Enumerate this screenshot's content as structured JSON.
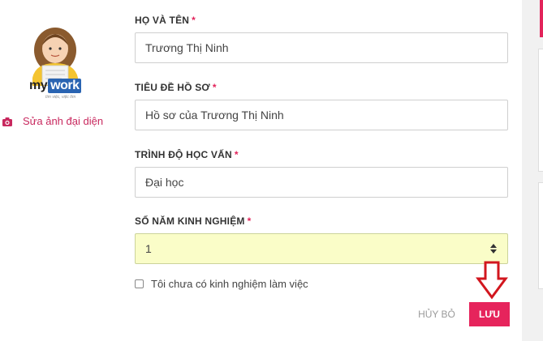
{
  "logo": {
    "brand_my": "my",
    "brand_work": "work",
    "tagline": "tìm việc, việc tìm"
  },
  "avatar": {
    "edit_label": "Sửa ảnh đại diện"
  },
  "form": {
    "full_name": {
      "label": "HỌ VÀ TÊN",
      "required_mark": "*",
      "value": "Trương Thị Ninh"
    },
    "profile_title": {
      "label": "TIÊU ĐỀ HỒ SƠ",
      "required_mark": "*",
      "value": "Hồ sơ của Trương Thị Ninh"
    },
    "education": {
      "label": "TRÌNH ĐỘ HỌC VẤN",
      "required_mark": "*",
      "value": "Đại học"
    },
    "experience_years": {
      "label": "SỐ NĂM KINH NGHIỆM",
      "required_mark": "*",
      "value": "1"
    },
    "no_experience": {
      "label": "Tôi chưa có kinh nghiệm làm việc",
      "checked": false
    }
  },
  "actions": {
    "cancel_label": "HỦY BỎ",
    "save_label": "LƯU"
  },
  "colors": {
    "accent": "#e6245c",
    "label_required": "#e2235a",
    "highlight_field": "#fafdc8",
    "annotation_arrow": "#d2161e"
  },
  "icons": [
    "camera-icon",
    "spinner-arrows-icon",
    "down-arrow-annotation-icon"
  ]
}
